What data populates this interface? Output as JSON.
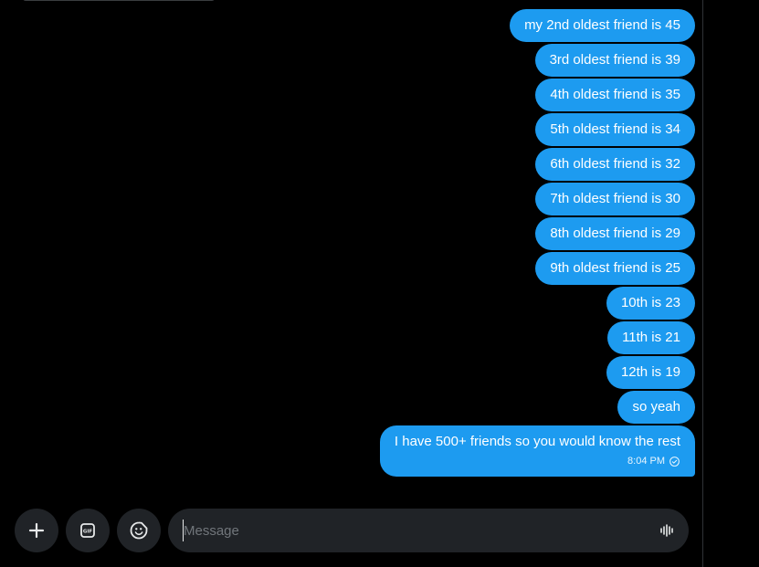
{
  "messages": [
    {
      "text": "my 2nd oldest friend is 45"
    },
    {
      "text": "3rd oldest friend is 39"
    },
    {
      "text": "4th oldest friend is 35"
    },
    {
      "text": "5th oldest friend is 34"
    },
    {
      "text": "6th oldest friend is 32"
    },
    {
      "text": "7th oldest friend is 30"
    },
    {
      "text": "8th oldest friend is 29"
    },
    {
      "text": "9th oldest friend is 25"
    },
    {
      "text": "10th is 23"
    },
    {
      "text": "11th is 21"
    },
    {
      "text": "12th is 19"
    },
    {
      "text": "so yeah"
    },
    {
      "text": "I have 500+ friends so you would know the rest",
      "time": "8:04 PM",
      "status_icon": "check-circle-icon"
    }
  ],
  "composer": {
    "placeholder": "Message",
    "buttons": [
      "add-icon",
      "gif-icon",
      "emoji-icon",
      "voice-icon"
    ]
  },
  "colors": {
    "accent": "#1d9bf0",
    "background": "#000000",
    "input_bg": "#202327"
  }
}
